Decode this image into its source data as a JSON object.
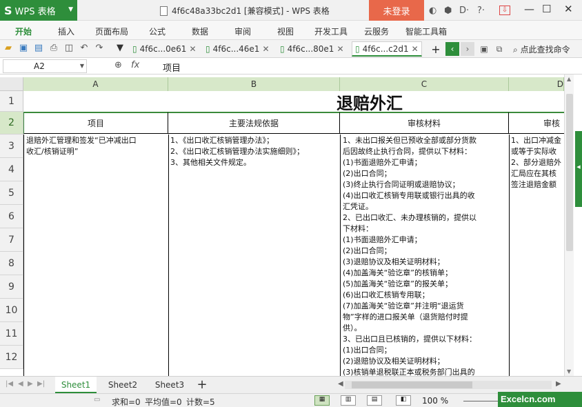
{
  "titlebar": {
    "app_button": "WPS 表格",
    "logo": "S",
    "doc_title": "4f6c48a33bc2d1 [兼容模式] - WPS 表格",
    "login": "未登录",
    "minimize": "—",
    "maximize": "☐",
    "close": "✕"
  },
  "menu": [
    "开始",
    "插入",
    "页面布局",
    "公式",
    "数据",
    "审阅",
    "视图",
    "开发工具",
    "云服务",
    "智能工具箱"
  ],
  "tabs": [
    {
      "label": "4f6c...0e61"
    },
    {
      "label": "4f6c...46e1"
    },
    {
      "label": "4f6c...80e1"
    },
    {
      "label": "4f6c...c2d1"
    }
  ],
  "search": "点此查找命令",
  "formula_bar": {
    "name_box": "A2",
    "fx": "fx",
    "content": "项目"
  },
  "columns": [
    "A",
    "B",
    "C",
    "D"
  ],
  "rows": [
    "1",
    "2",
    "3",
    "4",
    "5",
    "6",
    "7",
    "8",
    "9",
    "10",
    "11",
    "12"
  ],
  "sheet": {
    "title": "退赔外汇",
    "headers": [
      "项目",
      "主要法规依据",
      "审核材料",
      "审核"
    ],
    "a3": "退赔外汇管理和签发“已冲减出口\n收汇/核销证明”",
    "b3": "1、《出口收汇核销管理办法》；\n2、《出口收汇核销管理办法实施细则》；\n3、其他相关文件规定。",
    "c3": "1、未出口报关但已预收全部或部分货款\n后因故终止执行合同，提供以下材料：\n(1)书面退赔外汇申请；\n(2)出口合同；\n(3)终止执行合同证明或退赔协议；\n(4)出口收汇核销专用联或银行出具的收\n汇凭证。\n2、已出口收汇、未办理核销的，提供以\n下材料：\n(1)书面退赔外汇申请；\n(2)出口合同；\n(3)退赔协议及相关证明材料；\n(4)加盖海关“验讫章”的核销单；\n(5)加盖海关“验讫章”的报关单；\n(6)出口收汇核销专用联；\n(7)加盖海关“验讫章”并注明“退运货\n物”字样的进口报关单（退货赔付时提\n供）。\n3、已出口且已核销的，提供以下材料：\n(1)出口合同；\n(2)退赔协议及相关证明材料；\n(3)核销单退税联正本或税务部门出具的",
    "d3": "1、出口冲减金\n或等于实际收\n2、部分退赔外\n汇局应在其核\n签注退赔金额"
  },
  "sheet_tabs": [
    "Sheet1",
    "Sheet2",
    "Sheet3"
  ],
  "add_sheet": "+",
  "status": {
    "sum": "求和=0",
    "avg": "平均值=0",
    "count": "计数=5",
    "zoom": "100 %"
  },
  "brand": "Excelcn.com"
}
